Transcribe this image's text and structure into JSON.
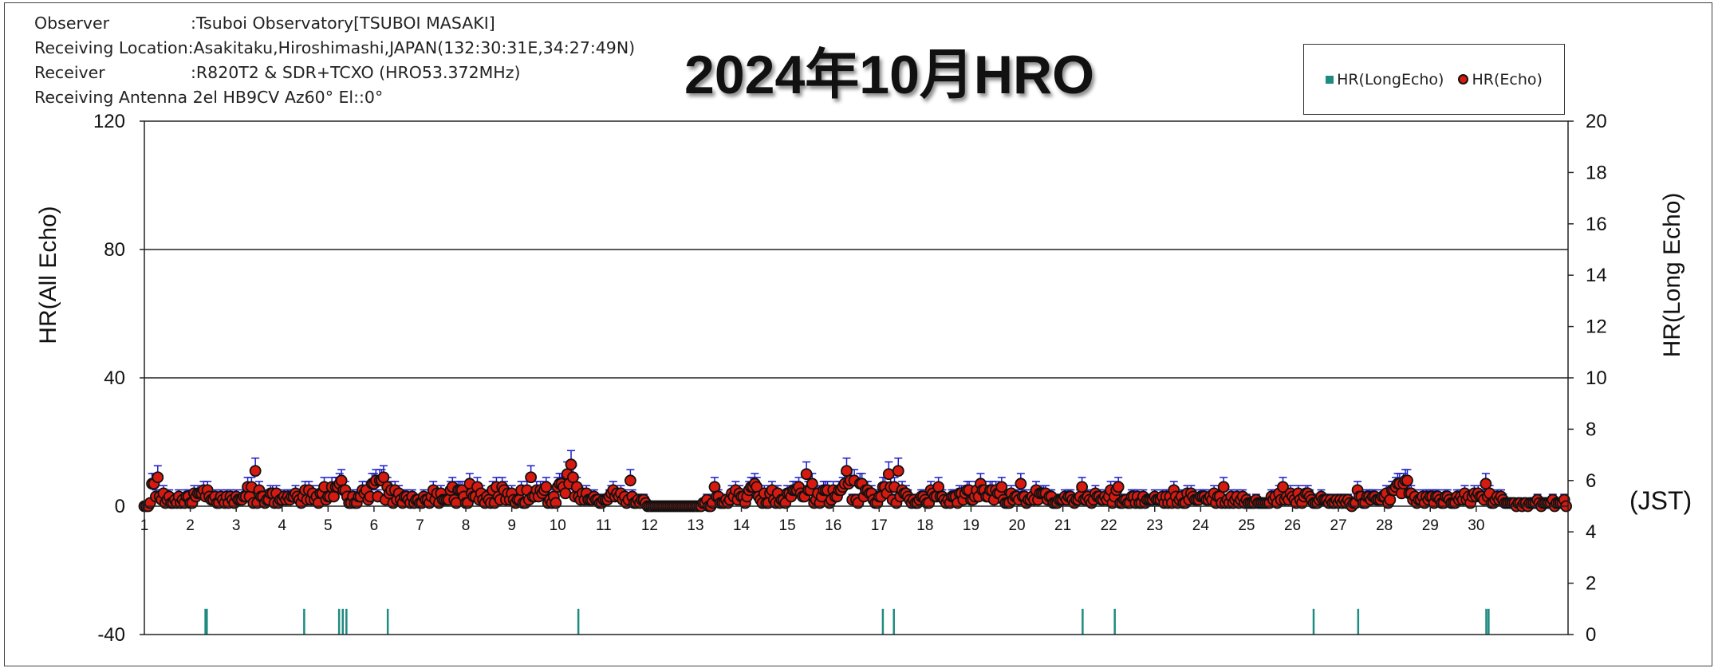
{
  "info": {
    "observer_label": "Observer",
    "observer_value": ":Tsuboi Observatory[TSUBOI MASAKI]",
    "location_label": "Receiving Location",
    "location_value": ":Asakitaku,Hiroshimashi,JAPAN(132:30:31E,34:27:49N)",
    "receiver_label": "Receiver",
    "receiver_value": ":R820T2 & SDR+TCXO (HRO53.372MHz)",
    "antenna_label": "Receiving Antenna",
    "antenna_value": " 2el HB9CV Az60° El::0°"
  },
  "chart_data": {
    "type": "scatter",
    "title": "2024年10月HRO",
    "ylabel_left": "HR(All Echo)",
    "ylabel_right": "HR(Long Echo)",
    "xlabel": "(JST)",
    "x_ticks": [
      "1",
      "2",
      "3",
      "4",
      "5",
      "6",
      "7",
      "8",
      "9",
      "10",
      "11",
      "12",
      "13",
      "14",
      "15",
      "16",
      "17",
      "18",
      "19",
      "20",
      "21",
      "22",
      "23",
      "24",
      "25",
      "26",
      "27",
      "28",
      "29",
      "30"
    ],
    "x_range": [
      1,
      32
    ],
    "y_left_range": [
      -40,
      120
    ],
    "y_left_ticks": [
      -40,
      0,
      40,
      80,
      120
    ],
    "y_left_grid": [
      40,
      80
    ],
    "y_right_range": [
      0,
      20
    ],
    "y_right_ticks": [
      0,
      2,
      4,
      6,
      8,
      10,
      12,
      14,
      16,
      18,
      20
    ],
    "colors": {
      "echo_fill": "#d61a10",
      "echo_stroke": "#111111",
      "long_echo": "#1e8a80",
      "error_bar": "#1a1acc"
    },
    "legend": {
      "position": "top-right",
      "entries": [
        "HR(LongEcho)",
        "HR(Echo)"
      ]
    },
    "series": [
      {
        "name": "HR(Echo)",
        "axis": "left",
        "profile_days": [
          1.0,
          1.1,
          1.2,
          1.5,
          2.0,
          2.3,
          2.5,
          3.0,
          3.3,
          3.5,
          4.0,
          4.5,
          4.8,
          5.0,
          5.3,
          5.6,
          6.0,
          6.3,
          6.6,
          7.0,
          7.5,
          8.0,
          8.5,
          9.0,
          9.5,
          10.0,
          10.2,
          10.5,
          11.0,
          11.4,
          11.8,
          12.0,
          12.5,
          13.0,
          13.5,
          14.0,
          14.3,
          14.6,
          15.0,
          15.4,
          15.7,
          16.0,
          16.4,
          16.8,
          17.0,
          17.4,
          17.8,
          18.0,
          18.5,
          19.0,
          19.5,
          20.0,
          20.5,
          21.0,
          21.5,
          22.0,
          22.5,
          23.0,
          23.5,
          24.0,
          24.5,
          25.0,
          25.5,
          26.0,
          26.5,
          27.0,
          27.5,
          28.0,
          28.4,
          28.7,
          29.0,
          29.5,
          30.0,
          30.4,
          30.8
        ],
        "profile_hr": [
          0,
          3,
          5,
          2,
          2,
          4,
          2,
          2,
          4,
          3,
          2,
          3,
          2,
          5,
          4,
          2,
          5,
          4,
          2,
          2,
          3,
          4,
          3,
          4,
          3,
          4,
          8,
          3,
          2,
          4,
          2,
          0,
          0,
          0,
          2,
          3,
          4,
          3,
          3,
          5,
          3,
          3,
          5,
          3,
          5,
          4,
          2,
          3,
          2,
          3,
          4,
          2,
          3,
          2,
          2,
          3,
          2,
          2,
          2,
          3,
          2,
          2,
          2,
          3,
          2,
          1,
          2,
          2,
          5,
          2,
          2,
          2,
          3,
          2,
          1
        ],
        "spikes": [
          [
            1.3,
            9
          ],
          [
            3.4,
            11
          ],
          [
            5.3,
            8
          ],
          [
            6.2,
            9
          ],
          [
            7.3,
            5
          ],
          [
            8.1,
            7
          ],
          [
            9.4,
            9
          ],
          [
            10.2,
            10
          ],
          [
            10.3,
            13
          ],
          [
            11.6,
            8
          ],
          [
            13.4,
            6
          ],
          [
            14.3,
            7
          ],
          [
            15.4,
            10
          ],
          [
            16.3,
            11
          ],
          [
            16.6,
            7
          ],
          [
            17.2,
            10
          ],
          [
            17.4,
            11
          ],
          [
            18.3,
            6
          ],
          [
            19.2,
            7
          ],
          [
            20.1,
            7
          ],
          [
            21.4,
            6
          ],
          [
            22.2,
            6
          ],
          [
            23.4,
            5
          ],
          [
            24.5,
            6
          ],
          [
            25.8,
            6
          ],
          [
            27.4,
            5
          ],
          [
            28.3,
            7
          ],
          [
            28.5,
            8
          ],
          [
            30.2,
            7
          ]
        ]
      },
      {
        "name": "HR(LongEcho)",
        "axis": "right",
        "x": [
          2.33,
          2.36,
          4.48,
          5.24,
          5.32,
          5.4,
          6.3,
          10.45,
          17.08,
          17.32,
          21.43,
          22.13,
          26.46,
          27.43,
          30.22,
          30.27
        ],
        "values": [
          1,
          1,
          1,
          1,
          1,
          1,
          1,
          1,
          1,
          1,
          1,
          1,
          1,
          1,
          1,
          1
        ]
      }
    ]
  }
}
